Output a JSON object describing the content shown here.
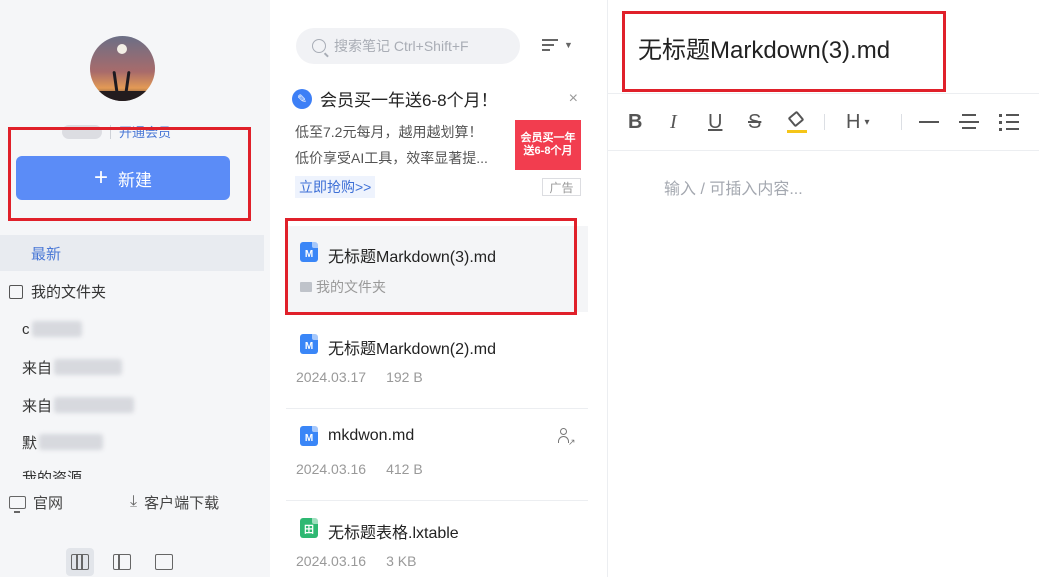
{
  "sidebar": {
    "vip_link": "开通会员",
    "new_button": "新建",
    "nav": {
      "latest": "最新",
      "my_folders": "我的文件夹"
    },
    "folders": [
      {
        "label": "c"
      },
      {
        "label": "来自"
      },
      {
        "label": "来自"
      },
      {
        "label": "默"
      },
      {
        "label": "我的资源"
      }
    ],
    "footer": {
      "website": "官网",
      "download": "客户端下载"
    }
  },
  "list": {
    "search_placeholder": "搜索笔记 Ctrl+Shift+F",
    "ad": {
      "title": "会员买一年送6-8个月！",
      "line1": "低至7.2元每月，越用越划算！",
      "line2": "低价享受AI工具，效率显著提...",
      "cta": "立即抢购>>",
      "image_line1": "会员买一年",
      "image_line2": "送6-8个月",
      "tag": "广告",
      "close": "×"
    },
    "notes": [
      {
        "title": "无标题Markdown(3).md",
        "folder": "我的文件夹",
        "type": "md-icon"
      },
      {
        "title": "无标题Markdown(2).md",
        "date": "2024.03.17",
        "size": "192 B",
        "type": "md-icon"
      },
      {
        "title": "mkdwon.md",
        "date": "2024.03.16",
        "size": "412 B",
        "type": "md-icon"
      },
      {
        "title": "无标题表格.lxtable",
        "date": "2024.03.16",
        "size": "3 KB",
        "type": "table-icon"
      }
    ],
    "file_icon_letter_md": "M",
    "file_icon_letter_table": "田"
  },
  "editor": {
    "title": "无标题Markdown(3).md",
    "placeholder": "输入 / 可插入内容...",
    "toolbar": {
      "bold": "B",
      "italic": "I",
      "underline": "U",
      "strike": "S",
      "heading": "H",
      "heading_caret": "▾"
    }
  },
  "colors": {
    "accent": "#5b8cf7",
    "annotation": "#e0202a",
    "ad_red": "#f23d4f"
  }
}
